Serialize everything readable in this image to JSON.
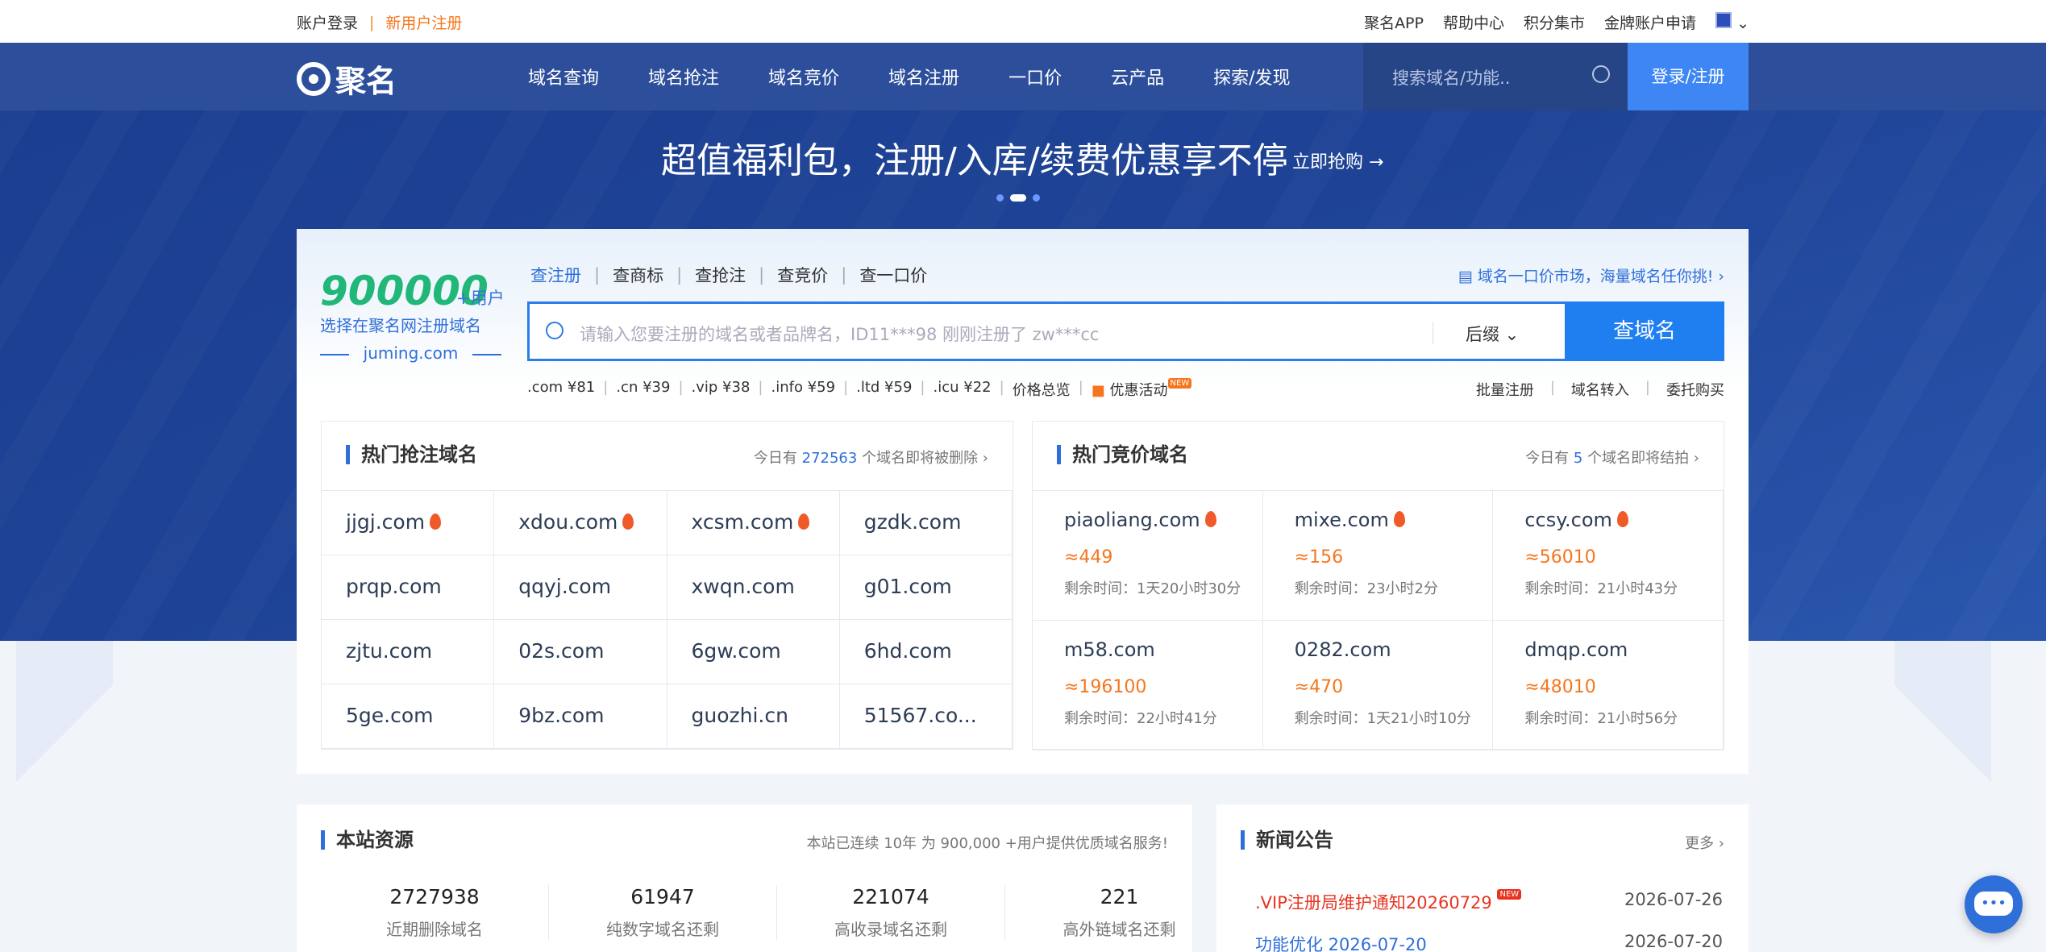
{
  "topbar": {
    "login": "账户登录",
    "sep": "|",
    "register": "新用户注册",
    "app": "聚名APP",
    "help": "帮助中心",
    "points": "积分集市",
    "gold": "金牌账户申请"
  },
  "nav": {
    "logo": "聚名",
    "items": [
      "域名查询",
      "域名抢注",
      "域名竞价",
      "域名注册",
      "一口价",
      "云产品",
      "探索/发现"
    ],
    "search_placeholder": "搜索域名/功能..",
    "login": "登录/注册"
  },
  "banner": {
    "title": "超值福利包，注册/入库/续费优惠享不停",
    "link": "立即抢购 →"
  },
  "search": {
    "count": "900000",
    "plus": "+用户",
    "slogan": "选择在聚名网注册域名",
    "site": "juming.com",
    "tabs": [
      "查注册",
      "查商标",
      "查抢注",
      "查竞价",
      "查一口价"
    ],
    "promo": "域名一口价市场，海量域名任你挑!",
    "placeholder": "请输入您要注册的域名或者品牌名，ID11***98 刚刚注册了 zw***cc",
    "suffix": "后缀",
    "button": "查域名",
    "prices": [
      ".com ¥81",
      ".cn ¥39",
      ".vip ¥38",
      ".info ¥59",
      ".ltd ¥59",
      ".icu ¥22",
      "价格总览",
      "优惠活动"
    ],
    "new": "NEW",
    "right_links": [
      "批量注册",
      "域名转入",
      "委托购买"
    ]
  },
  "hot_snap": {
    "title": "热门抢注域名",
    "note_pre": "今日有",
    "note_num": "272563",
    "note_post": "个域名即将被删除",
    "items": [
      "jjgj.com",
      "xdou.com",
      "xcsm.com",
      "gzdk.com",
      "prqp.com",
      "qqyj.com",
      "xwqn.com",
      "g01.com",
      "zjtu.com",
      "02s.com",
      "6gw.com",
      "6hd.com",
      "5ge.com",
      "9bz.com",
      "guozhi.cn",
      "51567.co..."
    ]
  },
  "hot_bid": {
    "title": "热门竞价域名",
    "note_pre": "今日有",
    "note_num": "5",
    "note_post": "个域名即将结拍",
    "items": [
      {
        "d": "piaoliang.com",
        "p": "≈449",
        "r": "剩余时间：1天20小时30分"
      },
      {
        "d": "mixe.com",
        "p": "≈156",
        "r": "剩余时间：23小时2分"
      },
      {
        "d": "ccsy.com",
        "p": "≈56010",
        "r": "剩余时间：21小时43分"
      },
      {
        "d": "m58.com",
        "p": "≈196100",
        "r": "剩余时间：22小时41分"
      },
      {
        "d": "0282.com",
        "p": "≈470",
        "r": "剩余时间：1天21小时10分"
      },
      {
        "d": "dmqp.com",
        "p": "≈48010",
        "r": "剩余时间：21小时56分"
      }
    ]
  },
  "resources": {
    "title": "本站资源",
    "note": "本站已连续 10年 为 900,000 +用户提供优质域名服务!",
    "stats": [
      {
        "n": "2727938",
        "l": "近期删除域名"
      },
      {
        "n": "61947",
        "l": "纯数字域名还剩"
      },
      {
        "n": "221074",
        "l": "高收录域名还剩"
      },
      {
        "n": "221",
        "l": "高外链域名还剩"
      }
    ]
  },
  "news": {
    "title": "新闻公告",
    "more": "更多",
    "items": [
      {
        "t": ".VIP注册局维护通知20260729",
        "d": "2026-07-26"
      },
      {
        "t": "功能优化 2026-07-20",
        "d": "2026-07-20"
      }
    ]
  }
}
